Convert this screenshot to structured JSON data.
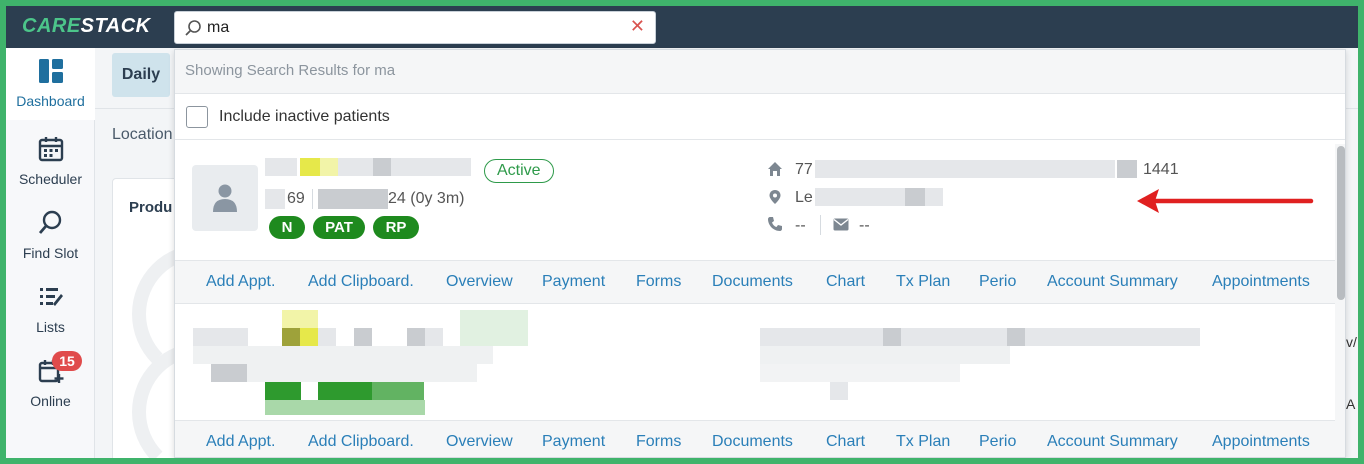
{
  "app": {
    "logo_care": "CARE",
    "logo_stack": "STACK"
  },
  "search": {
    "value": "ma",
    "clear_icon": "close-icon"
  },
  "sidebar": {
    "items": [
      {
        "label": "Dashboard",
        "icon": "dashboard-icon",
        "active": true
      },
      {
        "label": "Scheduler",
        "icon": "calendar-icon"
      },
      {
        "label": "Find Slot",
        "icon": "search-icon"
      },
      {
        "label": "Lists",
        "icon": "list-icon"
      },
      {
        "label": "Online",
        "icon": "calendar-add-icon",
        "badge": "15"
      }
    ]
  },
  "background": {
    "daily_tab": "Daily",
    "location_label": "Location",
    "panel_title": "Produ",
    "right_text_1": "v/",
    "right_text_2": "A"
  },
  "dropdown": {
    "header": "Showing Search Results for ma",
    "include_inactive_label": "Include inactive patients",
    "results": [
      {
        "status": "Active",
        "patient_id_fragment": "69",
        "dob_fragment": "24 (0y 3m)",
        "tags": [
          "N",
          "PAT",
          "RP"
        ],
        "address_start": "77",
        "address_end": "1441",
        "location_start": "Le",
        "phone": "--",
        "email": "--"
      }
    ],
    "actions": [
      "Add Appt.",
      "Add Clipboard.",
      "Overview",
      "Payment",
      "Forms",
      "Documents",
      "Chart",
      "Tx Plan",
      "Perio",
      "Account Summary",
      "Appointments"
    ]
  },
  "colors": {
    "topbar": "#2c3e50",
    "accent_green": "#4cc58a",
    "link_blue": "#2a7fb8",
    "tag_green": "#1e8a1e",
    "badge_red": "#e04b4b",
    "arrow_red": "#e02020"
  }
}
